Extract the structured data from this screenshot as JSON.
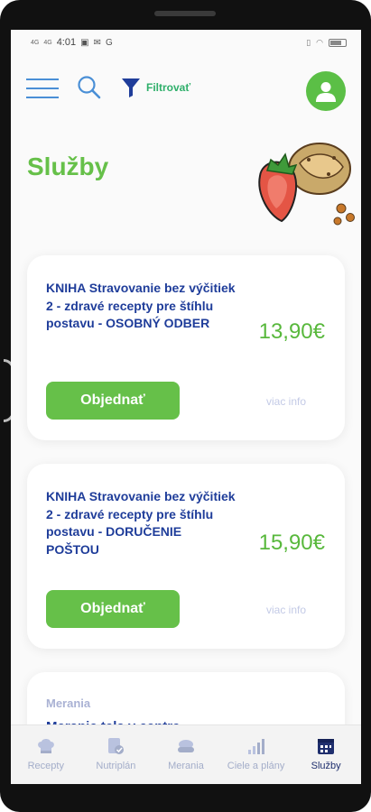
{
  "status_bar": {
    "network_1": "4G",
    "network_2": "4G",
    "time": "4:01",
    "app_letter": "G"
  },
  "header": {
    "filter_label": "Filtrovať"
  },
  "page": {
    "title": "Služby"
  },
  "products": [
    {
      "title": "KNIHA Stravovanie bez výčitiek 2 - zdravé recepty pre štíhlu postavu - OSOBNÝ ODBER",
      "price": "13,90€",
      "order_label": "Objednať",
      "more_label": "viac info"
    },
    {
      "title": "KNIHA Stravovanie bez výčitiek 2 - zdravé recepty pre štíhlu postavu - DORUČENIE POŠTOU",
      "price": "15,90€",
      "order_label": "Objednať",
      "more_label": "viac info"
    },
    {
      "category": "Merania",
      "title": "Meranie tela v centre"
    }
  ],
  "bottom_nav": [
    {
      "label": "Recepty",
      "icon": "chef-hat-icon"
    },
    {
      "label": "Nutriplán",
      "icon": "nutriplan-icon"
    },
    {
      "label": "Merania",
      "icon": "scale-icon"
    },
    {
      "label": "Ciele a plány",
      "icon": "bar-chart-icon"
    },
    {
      "label": "Služby",
      "icon": "services-icon",
      "active": true
    }
  ],
  "colors": {
    "brand_green": "#66c049",
    "title_blue": "#1f3d9a",
    "accent_blue": "#4a8fd6"
  }
}
